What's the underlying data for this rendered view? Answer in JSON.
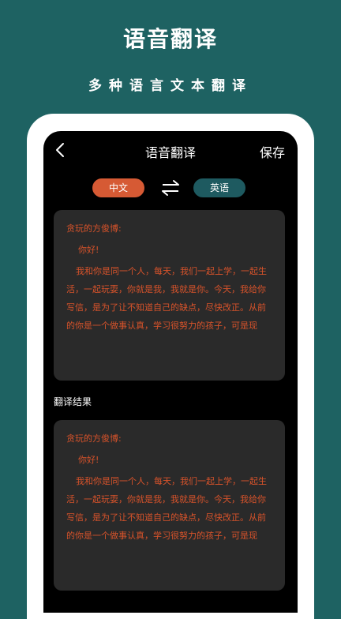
{
  "promo": {
    "title": "语音翻译",
    "subtitle": "多种语言文本翻译"
  },
  "nav": {
    "title": "语音翻译",
    "save_label": "保存"
  },
  "languages": {
    "source": "中文",
    "target": "英语"
  },
  "source_text": {
    "salutation": "贪玩的方俊博:",
    "greeting": "你好!",
    "body": "我和你是同一个人，每天，我们一起上学，一起生活，一起玩耍，你就是我，我就是你。今天，我给你写信，是为了让不知道自己的缺点，尽快改正。从前的你是一个做事认真，学习很努力的孩子，可是现"
  },
  "result_section_label": "翻译结果",
  "result_text": {
    "salutation": "贪玩的方俊博:",
    "greeting": "你好!",
    "body": "我和你是同一个人，每天，我们一起上学，一起生活，一起玩耍，你就是我，我就是你。今天，我给你写信，是为了让不知道自己的缺点，尽快改正。从前的你是一个做事认真，学习很努力的孩子，可是现"
  },
  "colors": {
    "background": "#1e6262",
    "source_pill": "#d65a34",
    "target_pill": "#1e5a60",
    "card_text": "#d8532a",
    "card_bg": "#2a2a2a"
  },
  "icons": {
    "back": "chevron-left-icon",
    "swap": "swap-arrows-icon"
  }
}
